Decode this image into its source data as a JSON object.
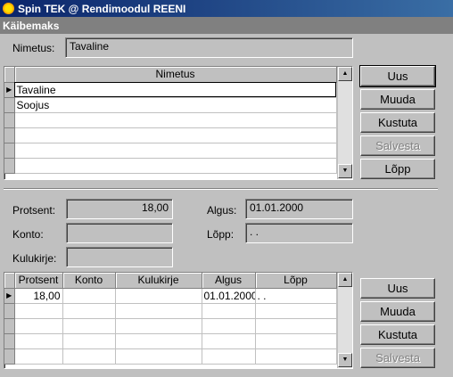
{
  "window": {
    "title": "Spin TEK @ Rendimoodul REENI"
  },
  "form": {
    "title": "Käibemaks"
  },
  "nimetus": {
    "label": "Nimetus:",
    "value": "Tavaline"
  },
  "top_grid": {
    "header": "Nimetus",
    "rows": [
      "Tavaline",
      "Soojus",
      "",
      "",
      "",
      ""
    ]
  },
  "top_buttons": {
    "uus": "Uus",
    "muuda": "Muuda",
    "kustuta": "Kustuta",
    "salvesta": "Salvesta",
    "lopp": "Lõpp"
  },
  "details": {
    "protsent_label": "Protsent:",
    "protsent_value": "18,00",
    "konto_label": "Konto:",
    "konto_value": "",
    "kulukirje_label": "Kulukirje:",
    "kulukirje_value": "",
    "algus_label": "Algus:",
    "algus_value": "01.01.2000",
    "lopp_label": "Lõpp:",
    "lopp_value": ". ."
  },
  "bottom_grid": {
    "headers": [
      "Protsent",
      "Konto",
      "Kulukirje",
      "Algus",
      "Lõpp"
    ],
    "rows": [
      [
        "18,00",
        "",
        "",
        "01.01.2000",
        ". ."
      ],
      [
        "",
        "",
        "",
        "",
        ""
      ],
      [
        "",
        "",
        "",
        "",
        ""
      ],
      [
        "",
        "",
        "",
        "",
        ""
      ],
      [
        "",
        "",
        "",
        "",
        ""
      ]
    ]
  },
  "bottom_buttons": {
    "uus": "Uus",
    "muuda": "Muuda",
    "kustuta": "Kustuta",
    "salvesta": "Salvesta"
  },
  "colors": {
    "titlebar": "#0a246a",
    "face": "#c0c0c0",
    "subheader": "#808080"
  }
}
